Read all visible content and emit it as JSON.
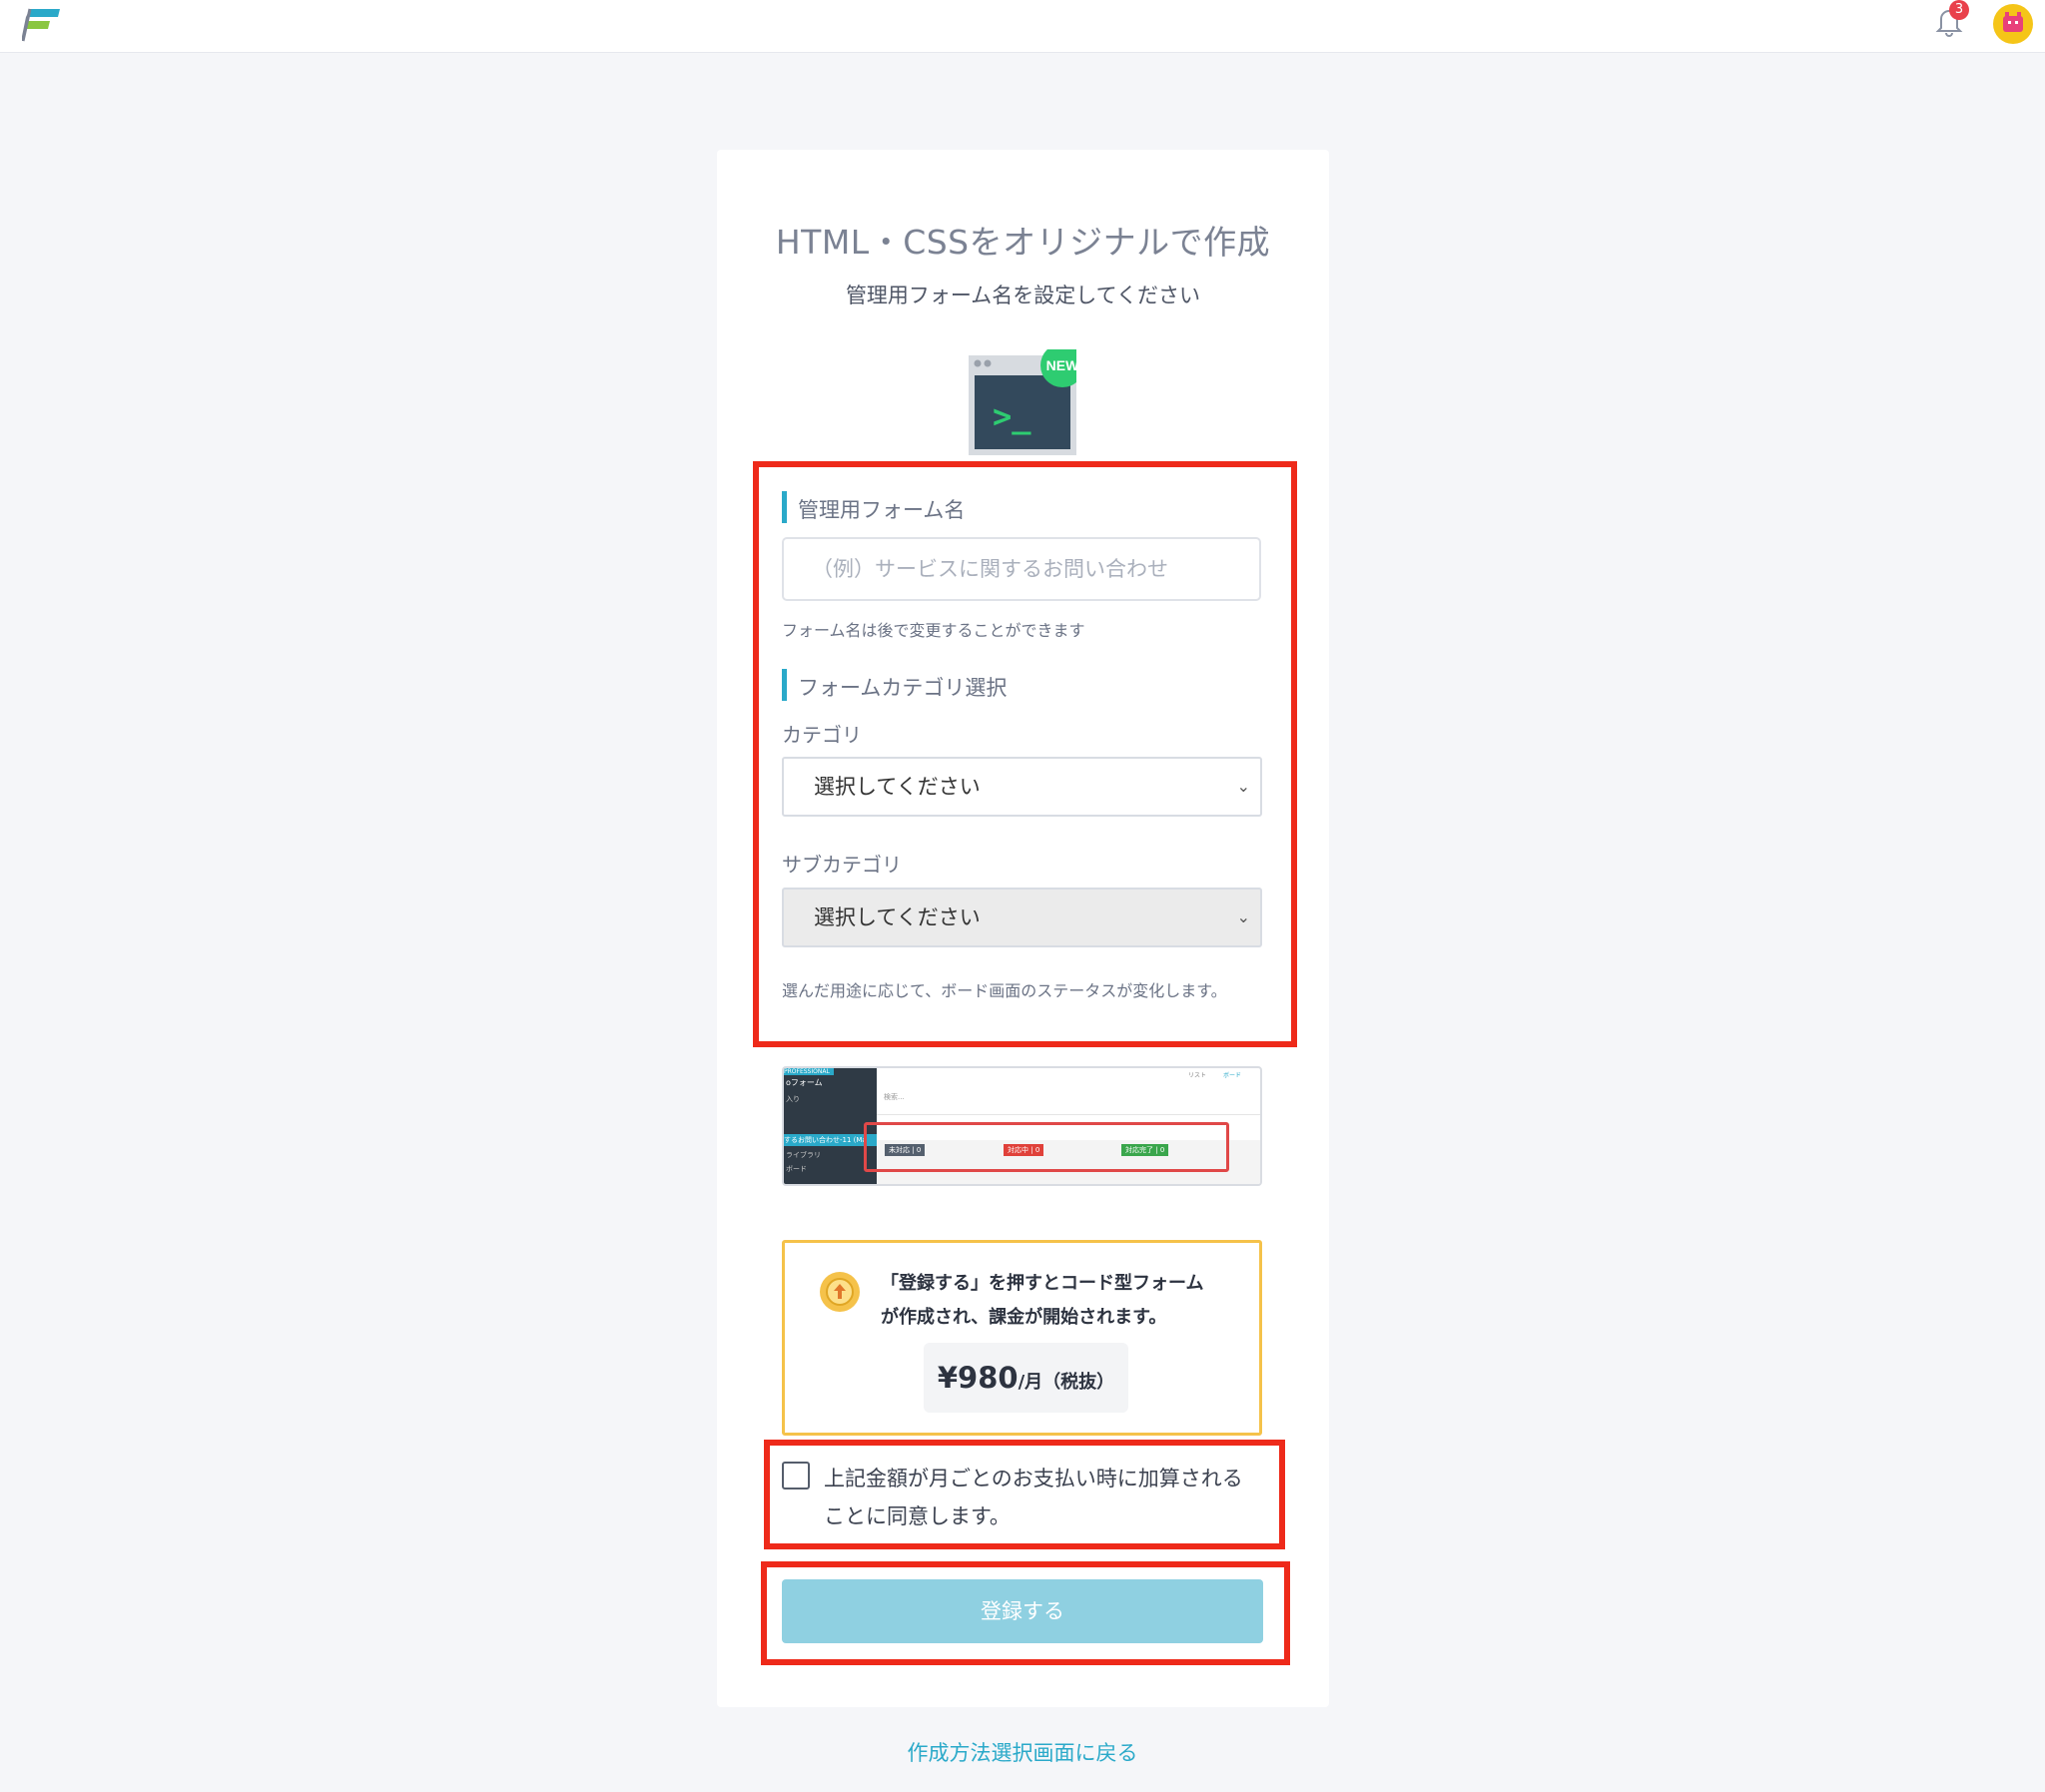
{
  "header": {
    "notification_count": "3"
  },
  "page": {
    "title": "HTML・CSSをオリジナルで作成",
    "subtitle": "管理用フォーム名を設定してください",
    "new_badge": "NEW",
    "terminal_prompt": ">_"
  },
  "form": {
    "name_label": "管理用フォーム名",
    "name_placeholder": "（例）サービスに関するお問い合わせ",
    "name_help": "フォーム名は後で変更することができます",
    "category_section_label": "フォームカテゴリ選択",
    "category_label": "カテゴリ",
    "category_value": "選択してください",
    "subcategory_label": "サブカテゴリ",
    "subcategory_value": "選択してください",
    "category_help": "選んだ用途に応じて、ボード画面のステータスが変化します。"
  },
  "preview": {
    "plan_badge": "PROFESSIONAL",
    "sidebar_items": [
      "oフォーム",
      "入り",
      "するお問い合わせ-11 (Ma",
      "ライブラリ",
      "ボード"
    ],
    "search_placeholder": "検索...",
    "view_tabs": [
      "リスト",
      "ボード"
    ],
    "statuses": [
      {
        "label": "未対応",
        "count": "0",
        "color": "#55606e"
      },
      {
        "label": "対応中",
        "count": "0",
        "color": "#e0413a"
      },
      {
        "label": "対応完了",
        "count": "0",
        "color": "#3aa64c"
      }
    ]
  },
  "notice": {
    "text_line1": "「登録する」を押すとコード型フォーム",
    "text_line2": "が作成され、課金が開始されます。",
    "price_amount": "¥980",
    "price_unit": "/月（税抜）"
  },
  "agreement": {
    "line1": "上記金額が月ごとのお支払い時に加算される",
    "line2": "ことに同意します。",
    "checked": false
  },
  "submit": {
    "label": "登録する"
  },
  "back_link": "作成方法選択画面に戻る",
  "colors": {
    "accent": "#2aa9c9",
    "button_disabled": "#8fd0e1",
    "highlight": "#ee2a1a",
    "notice_border": "#f5c24a"
  }
}
